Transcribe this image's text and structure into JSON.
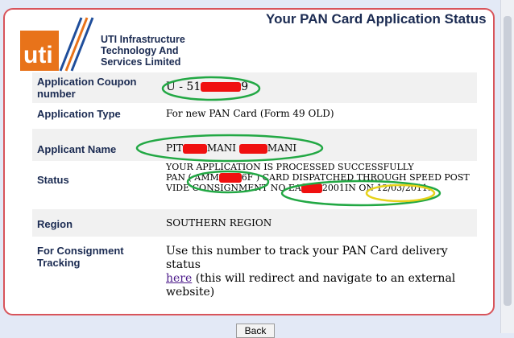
{
  "header": {
    "title": "Your PAN Card Application Status"
  },
  "logo": {
    "mark": "uti",
    "company_lines": [
      "UTI Infrastructure",
      "Technology And",
      "Services Limited"
    ]
  },
  "fields": {
    "coupon": {
      "label": "Application Coupon number",
      "value_prefix": "U - 51",
      "value_suffix": "9"
    },
    "type": {
      "label": "Application Type",
      "value": "For new PAN Card (Form 49 OLD)"
    },
    "applicant": {
      "label": "Applicant Name",
      "value_prefix": "PIT",
      "value_mid": "MANI",
      "value_suffix": "MANI"
    },
    "status": {
      "label": "Status",
      "line1": "YOUR APPLICATION IS PROCESSED SUCCESSFULLY",
      "line2_a": "PAN ( AMM",
      "line2_b": "6F ) CARD DISPATCHED THROUGH SPEED POST",
      "line3_a": "VIDE CONSIGNMENT NO EA",
      "line3_b": "2001IN ON",
      "line3_date": "12/03/2011",
      "line3_end": "."
    },
    "region": {
      "label": "Region",
      "value": "SOUTHERN REGION"
    },
    "tracking": {
      "label": "For Consignment Tracking",
      "line1": "Use this number to track your PAN Card delivery status",
      "link": "here",
      "line2_rest": " (this will redirect and navigate to an external website)"
    }
  },
  "footer": {
    "back_label": "Back"
  },
  "colors": {
    "accent": "#1b2b52",
    "border": "#d8545b",
    "green_mark": "#22a844",
    "yellow_mark": "#e7d21a",
    "redaction": "#f01010",
    "logo_orange": "#e8731a",
    "logo_blue": "#1f4e9b"
  }
}
